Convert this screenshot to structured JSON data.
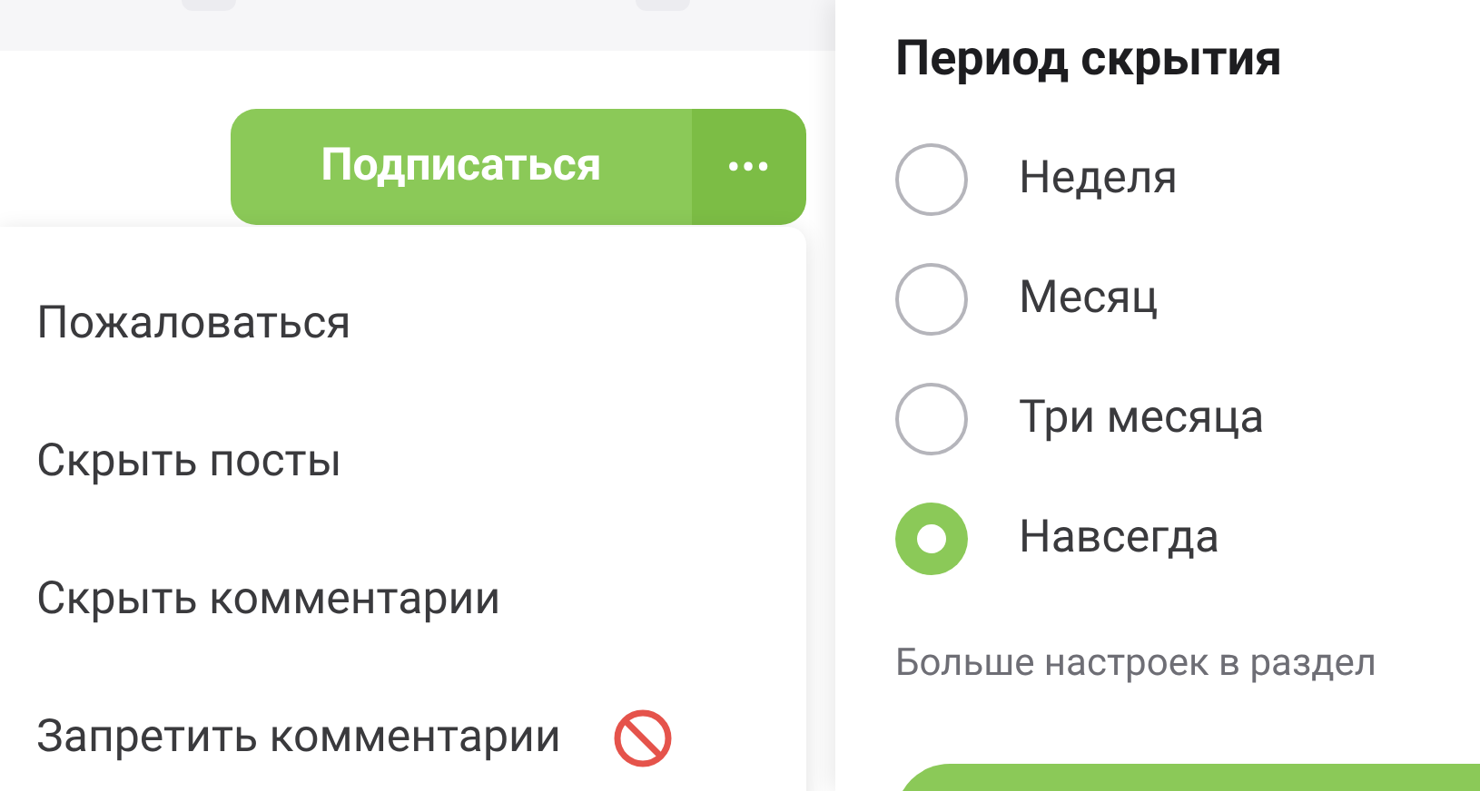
{
  "subscribe_button": {
    "label": "Подписаться",
    "more_label": "•••"
  },
  "menu": {
    "items": [
      {
        "label": "Пожаловаться",
        "kind": "plain"
      },
      {
        "label": "Скрыть посты",
        "kind": "plain"
      },
      {
        "label": "Скрыть комментарии",
        "kind": "plain"
      },
      {
        "label": "Запретить комментарии",
        "kind": "blocked"
      }
    ]
  },
  "panel": {
    "title": "Период скрытия",
    "options": [
      {
        "label": "Неделя",
        "selected": false
      },
      {
        "label": "Месяц",
        "selected": false
      },
      {
        "label": "Три месяца",
        "selected": false
      },
      {
        "label": "Навсегда",
        "selected": true
      }
    ],
    "note": "Больше настроек в раздел"
  }
}
